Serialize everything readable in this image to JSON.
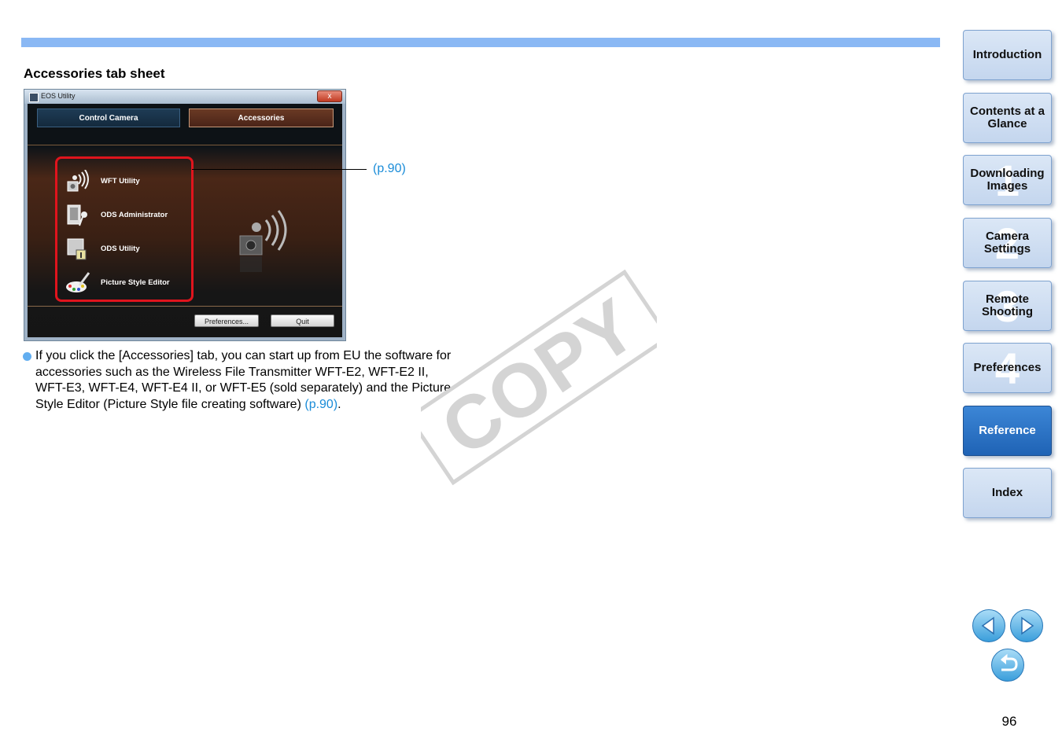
{
  "section": {
    "title": "Accessories tab sheet"
  },
  "window": {
    "title": "EOS Utility",
    "close": "x",
    "tabs": [
      "Control Camera",
      "Accessories"
    ],
    "apps": [
      "WFT Utility",
      "ODS Administrator",
      "ODS Utility",
      "Picture Style Editor"
    ],
    "buttons": {
      "preferences": "Preferences...",
      "quit": "Quit"
    }
  },
  "callout": {
    "link": "(p.90)"
  },
  "body": {
    "text": "If you click the [Accessories] tab, you can start up from EU the software for accessories such as the Wireless File Transmitter WFT-E2, WFT-E2 II, WFT-E3, WFT-E4, WFT-E4 II, or WFT-E5 (sold separately) and the Picture Style Editor (Picture Style file creating software) ",
    "link": "(p.90)",
    "end": "."
  },
  "watermark": "COPY",
  "nav": {
    "items": [
      {
        "label": "Introduction",
        "num": ""
      },
      {
        "label": "Contents at a Glance",
        "num": ""
      },
      {
        "label": "Downloading Images",
        "num": "1"
      },
      {
        "label": "Camera Settings",
        "num": "2"
      },
      {
        "label": "Remote Shooting",
        "num": "3"
      },
      {
        "label": "Preferences",
        "num": "4"
      },
      {
        "label": "Reference",
        "num": ""
      },
      {
        "label": "Index",
        "num": ""
      }
    ]
  },
  "page_number": "96",
  "colors": {
    "accent_bar": "#8ab8f4",
    "link": "#1a8cd8",
    "active_nav": "#2a70c2",
    "highlight_box": "#e0141d"
  }
}
